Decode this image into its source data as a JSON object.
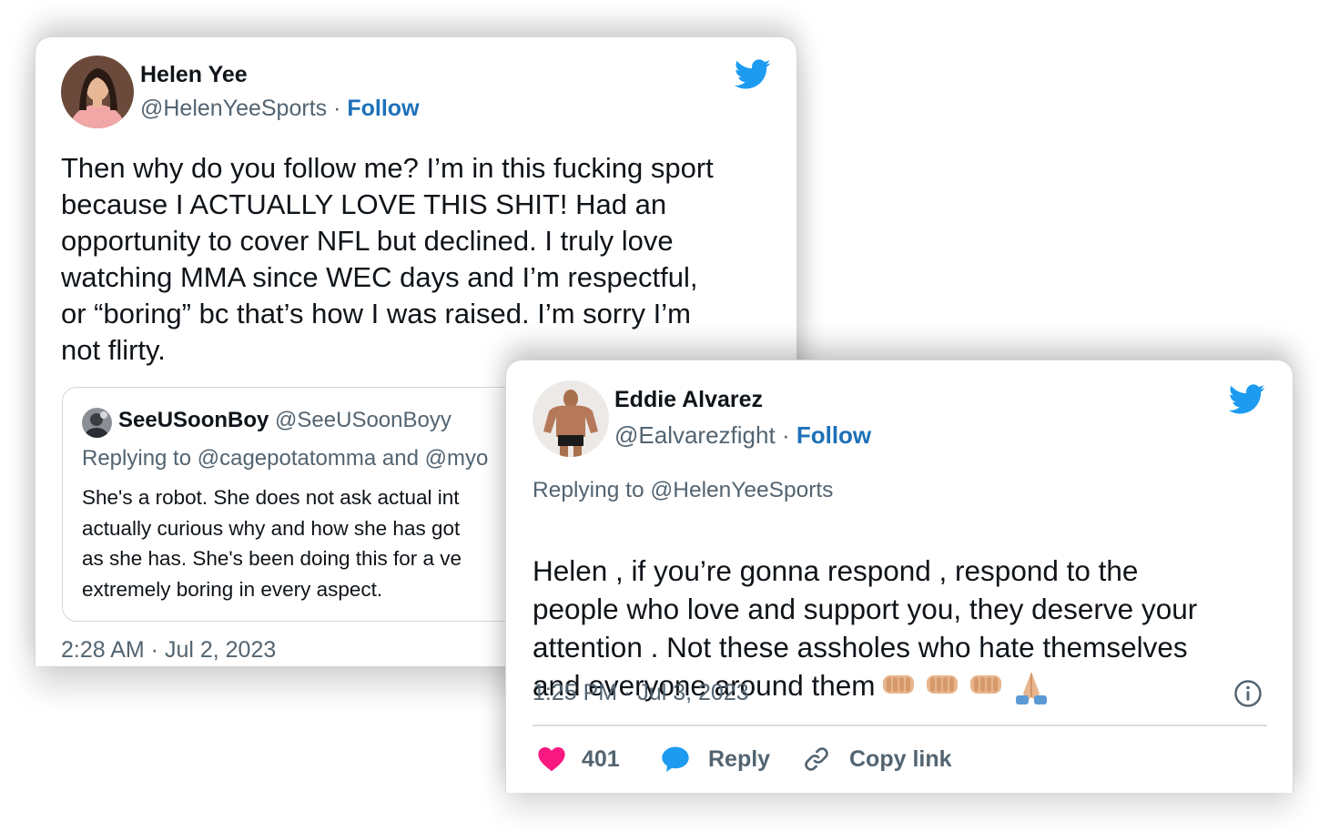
{
  "tweet1": {
    "name": "Helen Yee",
    "handle": "@HelenYeeSports",
    "separator": "·",
    "follow_label": "Follow",
    "text": "Then why do you follow me? I’m in this fucking sport\nbecause I ACTUALLY LOVE THIS SHIT! Had an\nopportunity to cover NFL but declined. I truly love\nwatching MMA since WEC days and I’m respectful,\nor “boring” bc that’s how I was raised. I’m sorry I’m\nnot flirty.",
    "timestamp": "2:28 AM · Jul 2, 2023",
    "quoted": {
      "name": "SeeUSoonBoy",
      "handle": "@SeeUSoonBoyy",
      "replying_to": "Replying to @cagepotatomma and @myo",
      "text": "She's a robot. She does not ask actual int\nactually curious why and how she has got\nas she has. She's been doing this for a ve\nextremely boring in every aspect."
    }
  },
  "tweet2": {
    "name": "Eddie Alvarez",
    "handle": "@Ealvarezfight",
    "separator": "·",
    "follow_label": "Follow",
    "replying_to": "Replying to @HelenYeeSports",
    "text": "Helen , if you’re gonna respond , respond to the\npeople who love and support you, they deserve your\nattention  . Not these assholes who hate themselves\nand everyone around them",
    "emojis": [
      "fist-emoji",
      "fist-emoji",
      "fist-emoji",
      "folded-hands-emoji"
    ],
    "timestamp": "1:25 PM · Jul 3, 2023",
    "actions": {
      "likes_count": "401",
      "reply_label": "Reply",
      "copy_link_label": "Copy link"
    }
  },
  "colors": {
    "twitter_blue": "#1d9bf0",
    "follow_blue": "#1d70b8",
    "like_pink": "#f91880",
    "text_primary": "#0f1419",
    "text_secondary": "#536471",
    "border": "#cfd9de"
  }
}
